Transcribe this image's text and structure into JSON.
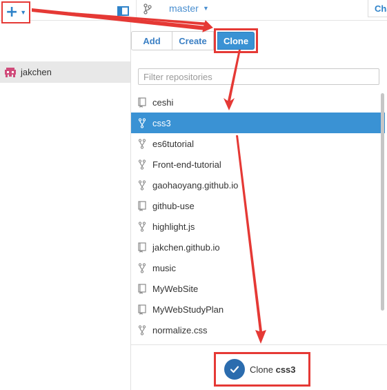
{
  "header": {
    "add_icon": "plus-icon",
    "branch_name": "master",
    "changes_tab": "Changes"
  },
  "sidebar": {
    "account": "jakchen"
  },
  "tabs": {
    "add": "Add",
    "create": "Create",
    "clone": "Clone"
  },
  "filter": {
    "placeholder": "Filter repositories",
    "value": ""
  },
  "repos": [
    {
      "name": "ceshi",
      "icon": "repo-icon",
      "selected": false
    },
    {
      "name": "css3",
      "icon": "fork-icon",
      "selected": true
    },
    {
      "name": "es6tutorial",
      "icon": "fork-icon",
      "selected": false
    },
    {
      "name": "Front-end-tutorial",
      "icon": "fork-icon",
      "selected": false
    },
    {
      "name": "gaohaoyang.github.io",
      "icon": "fork-icon",
      "selected": false
    },
    {
      "name": "github-use",
      "icon": "repo-icon",
      "selected": false
    },
    {
      "name": "highlight.js",
      "icon": "fork-icon",
      "selected": false
    },
    {
      "name": "jakchen.github.io",
      "icon": "repo-icon",
      "selected": false
    },
    {
      "name": "music",
      "icon": "fork-icon",
      "selected": false
    },
    {
      "name": "MyWebSite",
      "icon": "repo-icon",
      "selected": false
    },
    {
      "name": "MyWebStudyPlan",
      "icon": "repo-icon",
      "selected": false
    },
    {
      "name": "normalize.css",
      "icon": "fork-icon",
      "selected": false
    }
  ],
  "clone_action": {
    "label": "Clone",
    "repo": "css3"
  },
  "colors": {
    "accent": "#3a92d4",
    "annotation": "#e53935"
  }
}
